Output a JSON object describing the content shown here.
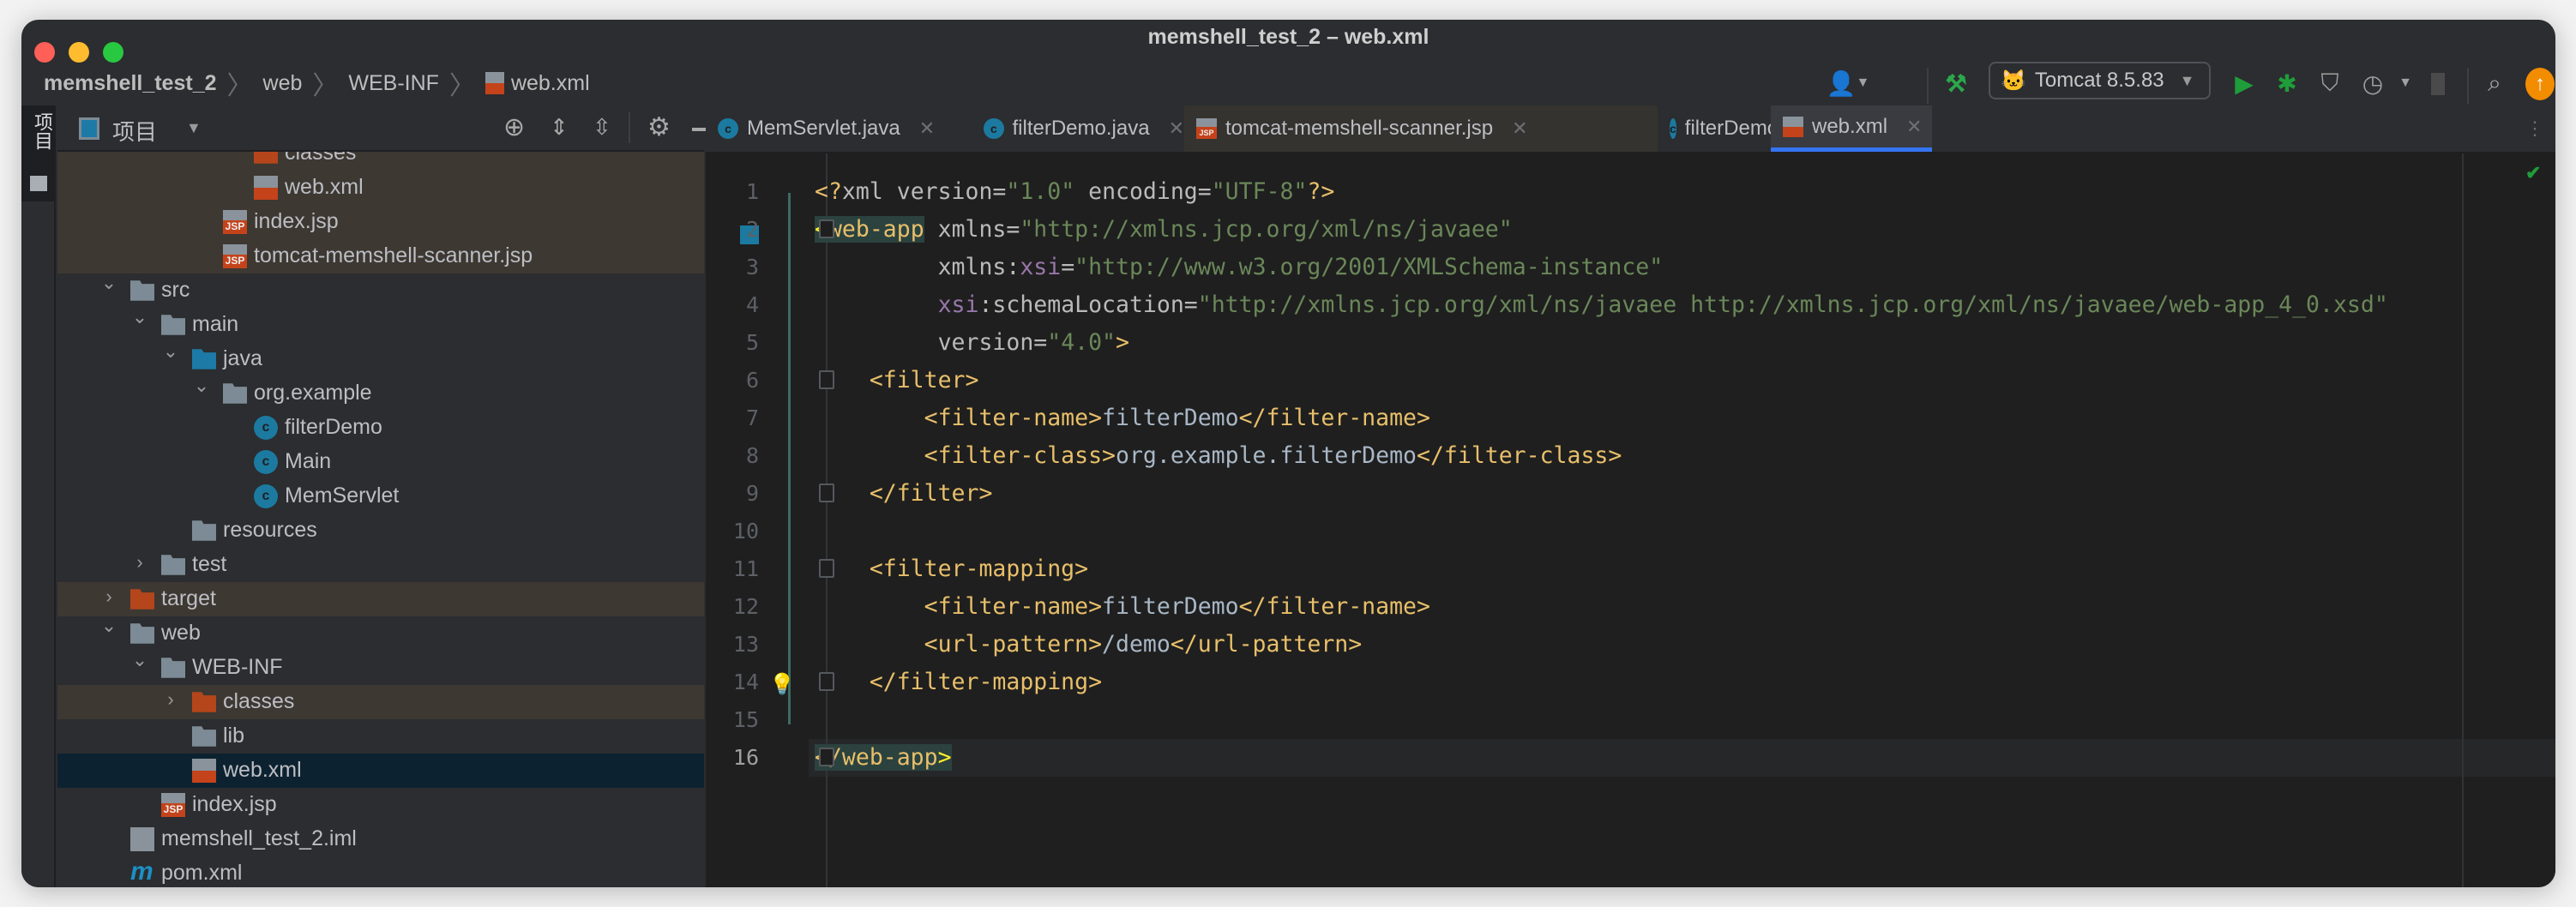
{
  "window": {
    "title": "memshell_test_2 – web.xml"
  },
  "breadcrumb": [
    "memshell_test_2",
    "web",
    "WEB-INF",
    "web.xml"
  ],
  "toolbar": {
    "run_config": "Tomcat 8.5.83",
    "colors": {
      "run": "#1f9d3a",
      "update": "#f28c00"
    }
  },
  "side_stripe": {
    "label": "项目"
  },
  "project_panel": {
    "title": "项目"
  },
  "tree": [
    {
      "label": "classes",
      "icon": "folder-orange",
      "level": 5,
      "chev": "open",
      "hl": true,
      "partial": true
    },
    {
      "label": "web.xml",
      "icon": "xml",
      "level": 5,
      "hl": true
    },
    {
      "label": "index.jsp",
      "icon": "jsp",
      "level": 4,
      "hl": true
    },
    {
      "label": "tomcat-memshell-scanner.jsp",
      "icon": "jsp",
      "level": 4,
      "hl": true
    },
    {
      "label": "src",
      "icon": "folder",
      "level": 1,
      "chev": "open"
    },
    {
      "label": "main",
      "icon": "folder",
      "level": 2,
      "chev": "open"
    },
    {
      "label": "java",
      "icon": "folder-blue",
      "level": 3,
      "chev": "open"
    },
    {
      "label": "org.example",
      "icon": "package",
      "level": 4,
      "chev": "open"
    },
    {
      "label": "filterDemo",
      "icon": "class",
      "level": 5
    },
    {
      "label": "Main",
      "icon": "class-main",
      "level": 5
    },
    {
      "label": "MemServlet",
      "icon": "class",
      "level": 5
    },
    {
      "label": "resources",
      "icon": "folder-resources",
      "level": 3
    },
    {
      "label": "test",
      "icon": "folder",
      "level": 2,
      "chev": "closed"
    },
    {
      "label": "target",
      "icon": "folder-orange",
      "level": 1,
      "chev": "closed",
      "hl": true
    },
    {
      "label": "web",
      "icon": "folder-web",
      "level": 1,
      "chev": "open"
    },
    {
      "label": "WEB-INF",
      "icon": "folder",
      "level": 2,
      "chev": "open"
    },
    {
      "label": "classes",
      "icon": "folder-orange",
      "level": 3,
      "chev": "closed",
      "hl": true
    },
    {
      "label": "lib",
      "icon": "folder",
      "level": 3
    },
    {
      "label": "web.xml",
      "icon": "xml",
      "level": 3,
      "selected": true
    },
    {
      "label": "index.jsp",
      "icon": "jsp",
      "level": 2
    },
    {
      "label": "memshell_test_2.iml",
      "icon": "iml",
      "level": 1
    },
    {
      "label": "pom.xml",
      "icon": "maven",
      "level": 1
    }
  ],
  "tabs": [
    {
      "label": "MemServlet.java",
      "icon": "class"
    },
    {
      "label": "filterDemo.java",
      "icon": "class"
    },
    {
      "label": "tomcat-memshell-scanner.jsp",
      "icon": "jsp"
    },
    {
      "label": "filterDemo.class",
      "icon": "class"
    },
    {
      "label": "web.xml",
      "icon": "xml",
      "active": true
    }
  ],
  "editor": {
    "current_line": 16,
    "lines": [
      [
        [
          "t",
          "<?"
        ],
        [
          "a",
          "xml version="
        ],
        [
          "s",
          "\"1.0\""
        ],
        [
          "a",
          " encoding="
        ],
        [
          "s",
          "\"UTF-8\""
        ],
        [
          "t",
          "?>"
        ]
      ],
      [
        [
          "hy",
          "<"
        ],
        [
          "ht",
          "web-app"
        ],
        [
          "a",
          " xmlns="
        ],
        [
          "s",
          "\"http://xmlns.jcp.org/xml/ns/javaee\""
        ]
      ],
      [
        [
          "a",
          "         xmlns:"
        ],
        [
          "n",
          "xsi"
        ],
        [
          "a",
          "="
        ],
        [
          "s",
          "\"http://www.w3.org/2001/XMLSchema-instance\""
        ]
      ],
      [
        [
          "a",
          "         "
        ],
        [
          "n",
          "xsi"
        ],
        [
          "a",
          ":schemaLocation="
        ],
        [
          "s",
          "\"http://xmlns.jcp.org/xml/ns/javaee http://xmlns.jcp.org/xml/ns/javaee/web-app_4_0.xsd\""
        ]
      ],
      [
        [
          "a",
          "         version="
        ],
        [
          "s",
          "\"4.0\""
        ],
        [
          "t",
          ">"
        ]
      ],
      [
        [
          "t",
          "    <filter>"
        ]
      ],
      [
        [
          "t",
          "        <filter-name>"
        ],
        [
          "x",
          "filterDemo"
        ],
        [
          "t",
          "</filter-name>"
        ]
      ],
      [
        [
          "t",
          "        <filter-class>"
        ],
        [
          "x",
          "org.example.filterDemo"
        ],
        [
          "t",
          "</filter-class>"
        ]
      ],
      [
        [
          "t",
          "    </filter>"
        ]
      ],
      [],
      [
        [
          "t",
          "    <filter-mapping>"
        ]
      ],
      [
        [
          "t",
          "        <filter-name>"
        ],
        [
          "x",
          "filterDemo"
        ],
        [
          "t",
          "</filter-name>"
        ]
      ],
      [
        [
          "t",
          "        <url-pattern>"
        ],
        [
          "x",
          "/demo"
        ],
        [
          "t",
          "</url-pattern>"
        ]
      ],
      [
        [
          "t",
          "    </filter-mapping>"
        ]
      ],
      [],
      [
        [
          "ht",
          "</web-app"
        ],
        [
          "hy",
          ">"
        ]
      ]
    ]
  }
}
